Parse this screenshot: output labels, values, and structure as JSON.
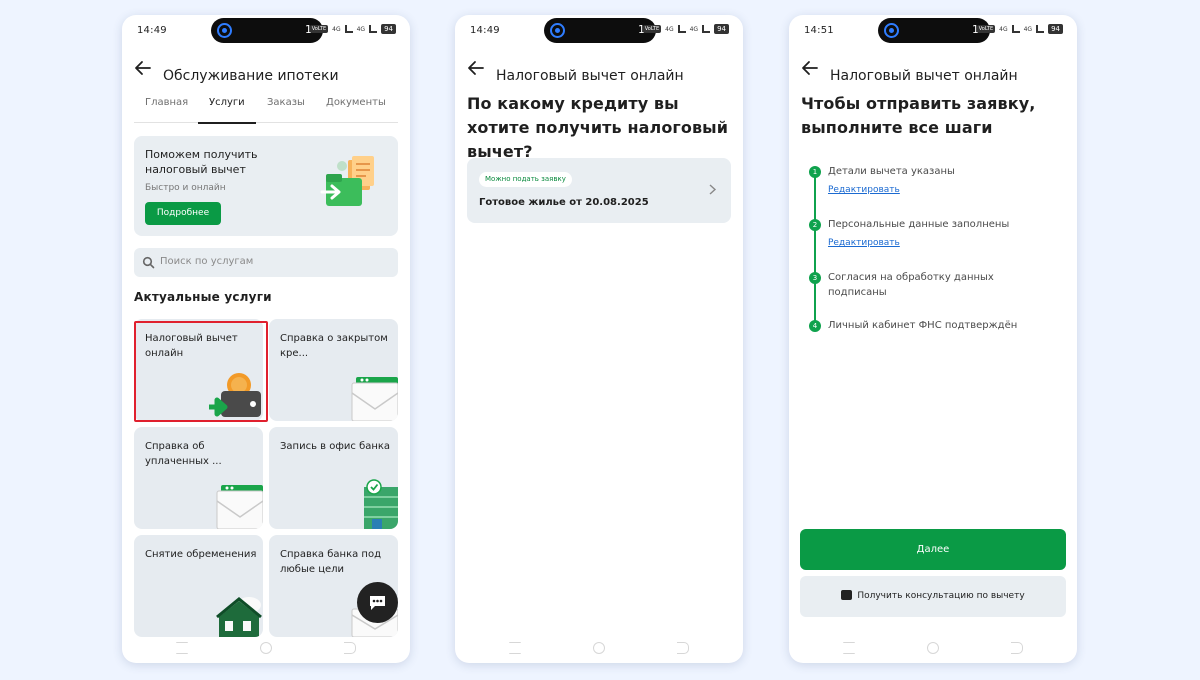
{
  "phone1": {
    "time": "14:49",
    "notif_num": "1",
    "battery": "94",
    "title": "Обслуживание ипотеки",
    "tabs": [
      "Главная",
      "Услуги",
      "Заказы",
      "Документы"
    ],
    "active_tab": "Услуги",
    "promo": {
      "title": "Поможем получить налоговый вычет",
      "subtitle": "Быстро и онлайн",
      "button": "Подробнее"
    },
    "search_placeholder": "Поиск по услугам",
    "section_title": "Актуальные услуги",
    "tiles": [
      {
        "label": "Налоговый вычет онлайн"
      },
      {
        "label": "Справка о закрытом кре..."
      },
      {
        "label": "Справка об уплаченных ..."
      },
      {
        "label": "Запись в офис банка"
      },
      {
        "label": "Снятие обременения"
      },
      {
        "label": "Справка банка под любые цели"
      }
    ]
  },
  "phone2": {
    "time": "14:49",
    "notif_num": "1",
    "battery": "94",
    "title": "Налоговый вычет онлайн",
    "heading": "По какому кредиту вы хотите получить налоговый вычет?",
    "credit": {
      "badge": "Можно подать заявку",
      "name": "Готовое жилье от 20.08.2025"
    }
  },
  "phone3": {
    "time": "14:51",
    "notif_num": "1",
    "battery": "94",
    "title": "Налоговый вычет онлайн",
    "heading": "Чтобы отправить заявку, выполните все шаги",
    "steps": [
      {
        "num": "1",
        "text": "Детали вычета указаны",
        "link": "Редактировать"
      },
      {
        "num": "2",
        "text": "Персональные данные заполнены",
        "link": "Редактировать"
      },
      {
        "num": "3",
        "text": "Согласия на обработку данных подписаны"
      },
      {
        "num": "4",
        "text": "Личный кабинет ФНС подтверждён"
      }
    ],
    "next_button": "Далее",
    "consult_button": "Получить консультацию по вычету"
  },
  "colors": {
    "background": "#eef4ff",
    "brand_green": "#0a9a45",
    "step_green": "#0fa24d",
    "card_bg": "#e9eef2",
    "highlight_red": "#e0202e",
    "link_blue": "#1b6ad1"
  },
  "status_bar": {
    "volte": "VoLTE",
    "net1": "4G",
    "net2": "4G"
  },
  "icons": [
    "back-arrow-icon",
    "search-icon",
    "chat-icon",
    "chevron-right-icon",
    "message-icon"
  ]
}
